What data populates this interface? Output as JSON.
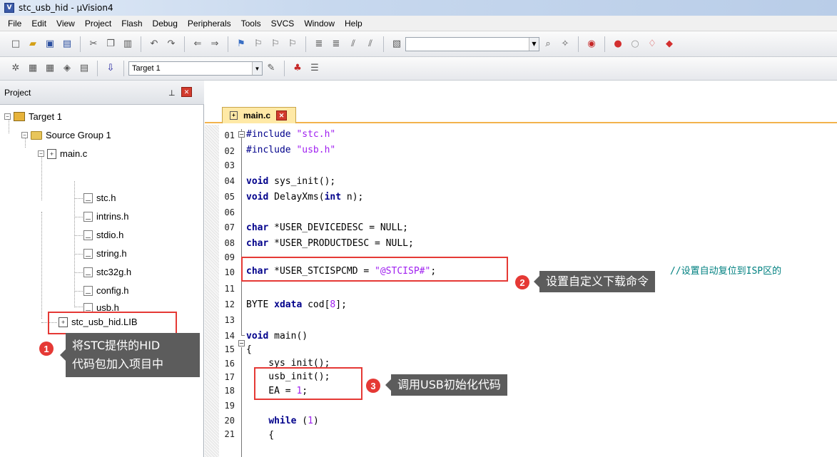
{
  "window": {
    "title": "stc_usb_hid - µVision4",
    "app_icon": "uvision-icon"
  },
  "menu": [
    "File",
    "Edit",
    "View",
    "Project",
    "Flash",
    "Debug",
    "Peripherals",
    "Tools",
    "SVCS",
    "Window",
    "Help"
  ],
  "toolbar2": {
    "target_select": "Target 1"
  },
  "project_panel": {
    "title": "Project"
  },
  "tree": {
    "target": "Target 1",
    "group": "Source Group 1",
    "main_file": "main.c",
    "includes": [
      "stc.h",
      "intrins.h",
      "stdio.h",
      "string.h",
      "stc32g.h",
      "config.h",
      "usb.h"
    ],
    "lib": "stc_usb_hid.LIB"
  },
  "editor": {
    "tab": "main.c",
    "line_numbers": [
      "01",
      "02",
      "03",
      "04",
      "05",
      "06",
      "07",
      "08",
      "09",
      "10",
      "11",
      "12",
      "13",
      "14",
      "15",
      "16",
      "17",
      "18",
      "19",
      "20",
      "21"
    ],
    "comment_fragment": "//设置自动复位到ISP区的"
  },
  "annotations": [
    {
      "num": "1",
      "text_line1": "将STC提供的HID",
      "text_line2": "代码包加入项目中"
    },
    {
      "num": "2",
      "text": "设置自定义下载命令"
    },
    {
      "num": "3",
      "text": "调用USB初始化代码"
    }
  ]
}
